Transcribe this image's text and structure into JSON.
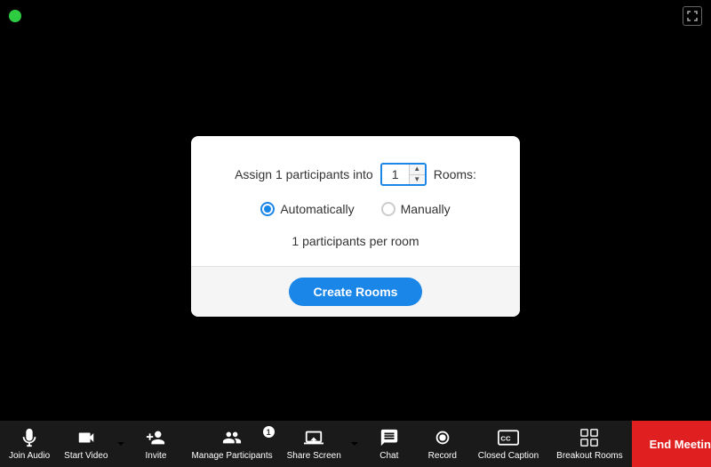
{
  "topbar": {
    "fullscreen_symbol": "⛶"
  },
  "modal": {
    "assign_text_before": "Assign 1 participants into",
    "rooms_value": "1",
    "assign_text_after": "Rooms:",
    "automatically_label": "Automatically",
    "manually_label": "Manually",
    "per_room_text": "1 participants per room",
    "create_rooms_label": "Create Rooms"
  },
  "toolbar": {
    "items": [
      {
        "id": "join-audio",
        "label": "Join Audio",
        "icon": "audio"
      },
      {
        "id": "start-video",
        "label": "Start Video",
        "icon": "video",
        "has_caret": true
      },
      {
        "id": "invite",
        "label": "Invite",
        "icon": "invite"
      },
      {
        "id": "manage-participants",
        "label": "Manage Participants",
        "icon": "participants",
        "badge": "1"
      },
      {
        "id": "share-screen",
        "label": "Share Screen",
        "icon": "share",
        "has_caret": true
      },
      {
        "id": "chat",
        "label": "Chat",
        "icon": "chat"
      },
      {
        "id": "record",
        "label": "Record",
        "icon": "record"
      },
      {
        "id": "closed-caption",
        "label": "Closed Caption",
        "icon": "cc"
      },
      {
        "id": "breakout-rooms",
        "label": "Breakout Rooms",
        "icon": "breakout"
      }
    ],
    "end_meeting_label": "End Meeting"
  },
  "colors": {
    "accent_blue": "#1a86e8",
    "end_meeting_red": "#e02020",
    "toolbar_bg": "#1a1a1a"
  }
}
